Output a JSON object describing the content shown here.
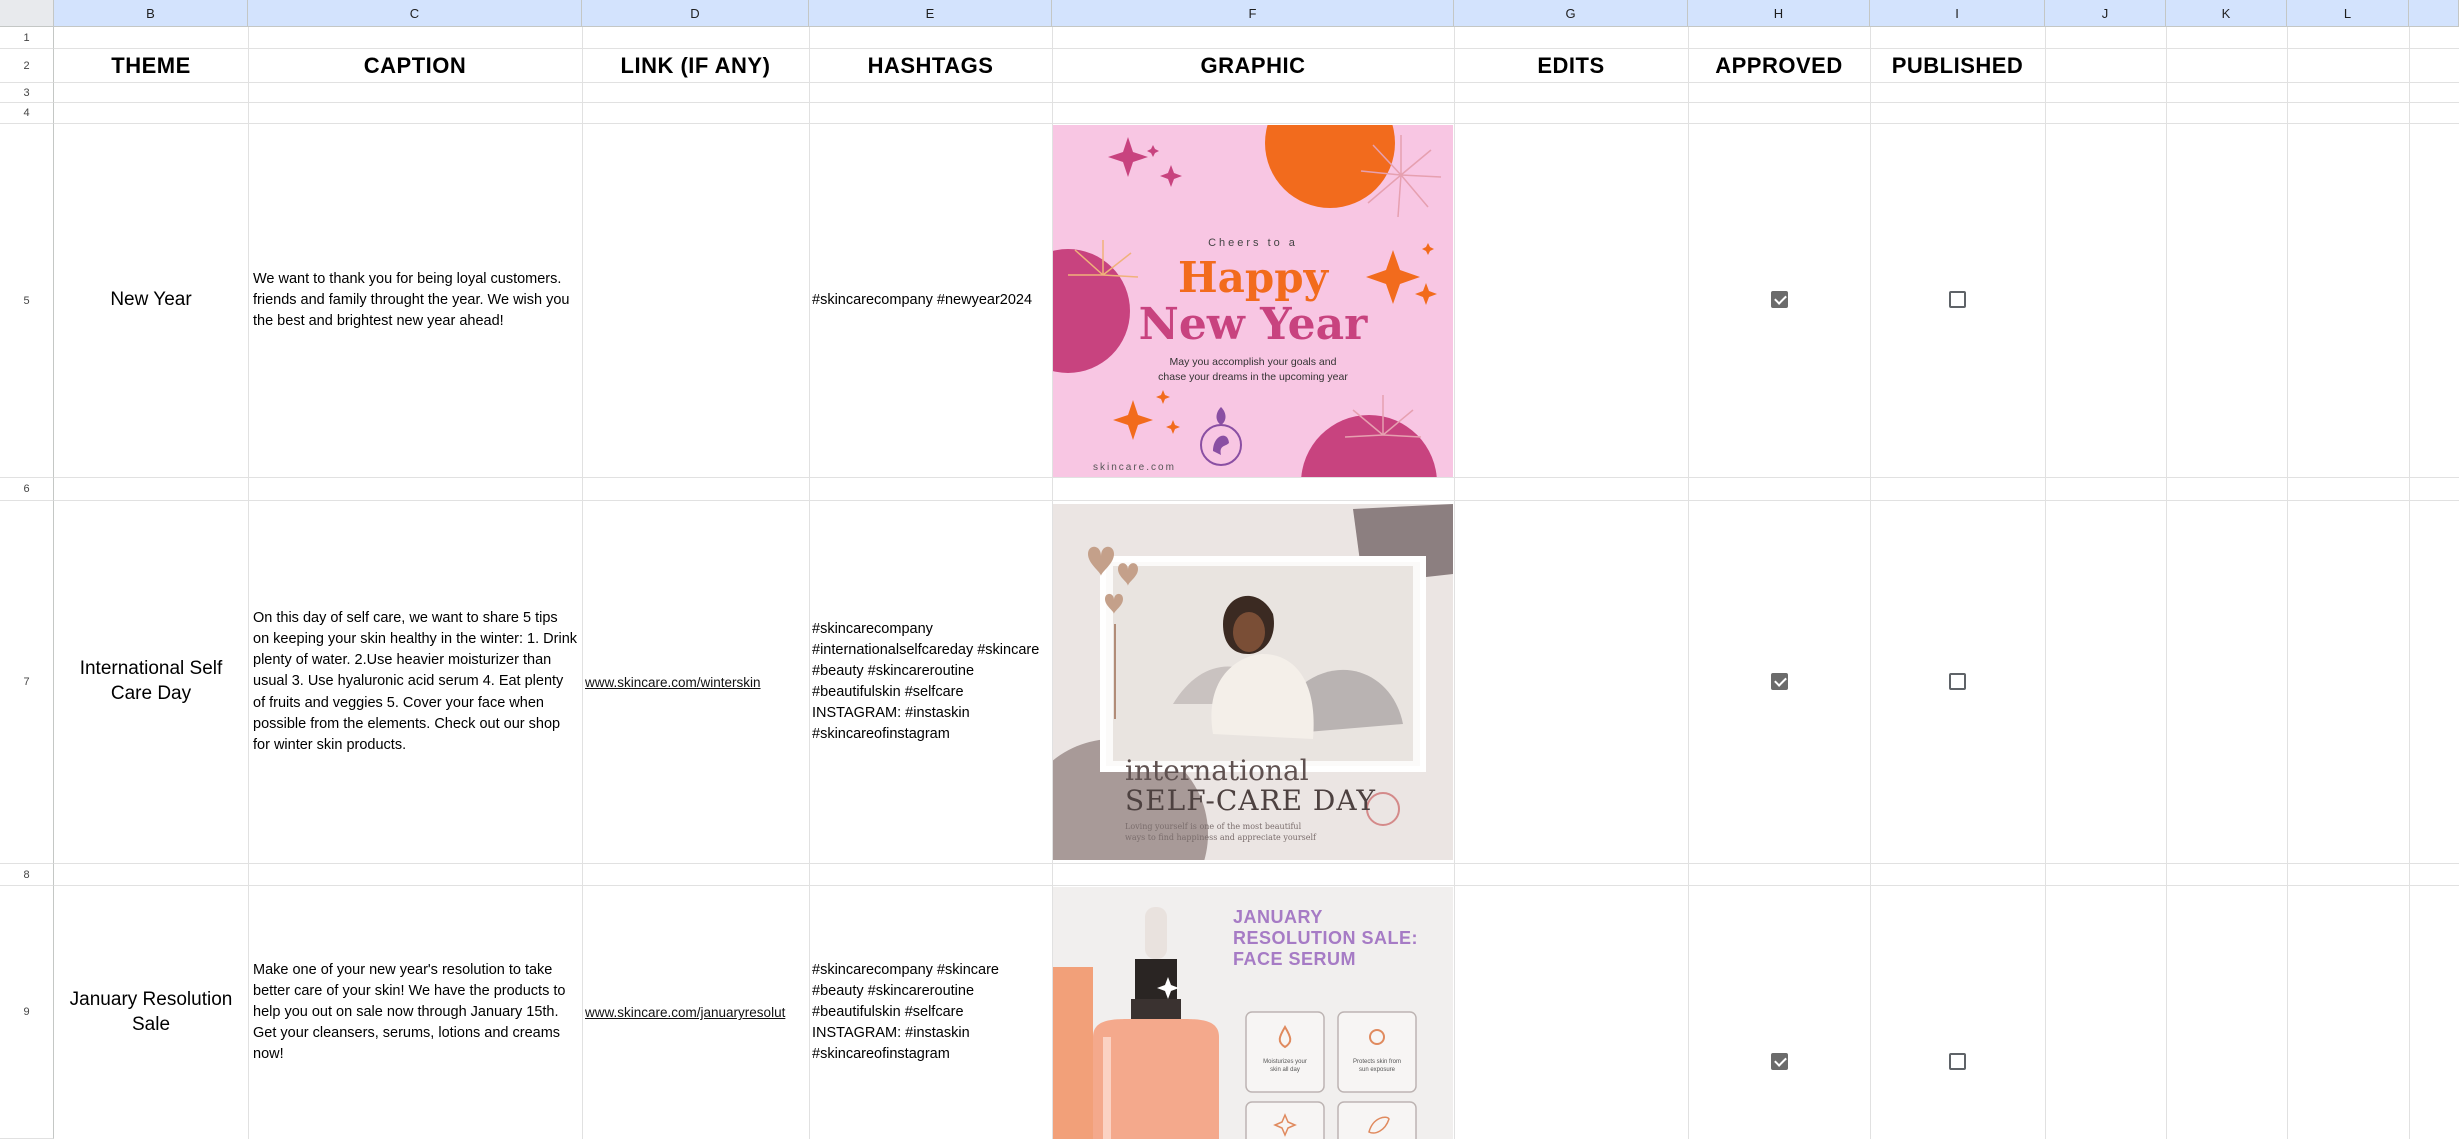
{
  "columns": [
    "B",
    "C",
    "D",
    "E",
    "F",
    "G",
    "H",
    "I",
    "J",
    "K",
    "L"
  ],
  "rows": [
    "1",
    "2",
    "3",
    "4",
    "5",
    "6",
    "7",
    "8",
    "9"
  ],
  "headers": {
    "theme": "THEME",
    "caption": "CAPTION",
    "link": "LINK (IF ANY)",
    "hashtags": "HASHTAGS",
    "graphic": "GRAPHIC",
    "edits": "EDITS",
    "approved": "APPROVED",
    "published": "PUBLISHED"
  },
  "entries": [
    {
      "theme": "New Year",
      "caption": "We want to thank you for being loyal customers. friends and family throught the year. We wish you the best and brightest new year ahead!",
      "link": "",
      "hashtags": "#skincarecompany #newyear2024",
      "approved": true,
      "published": false,
      "graphic": {
        "small": "Cheers to a",
        "line1": "Happy",
        "line2": "New Year",
        "sub1": "May you accomplish your goals and",
        "sub2": "chase your dreams in the upcoming year",
        "footer": "skincare.com"
      }
    },
    {
      "theme": "International Self Care Day",
      "caption": "On this day of self care, we want to share 5 tips on keeping your skin healthy in the winter: 1. Drink plenty of water. 2.Use heavier moisturizer than usual 3. Use hyaluronic acid serum 4. Eat plenty of fruits and veggies 5. Cover your face when possible from the elements. Check out our shop for winter skin products.",
      "link": "www.skincare.com/winterskin",
      "hashtags": "#skincarecompany #internationalselfcareday #skincare #beauty #skincareroutine #beautifulskin #selfcare INSTAGRAM: #instaskin #skincareofinstagram",
      "approved": true,
      "published": false,
      "graphic": {
        "line1": "international",
        "line2": "SELF-CARE DAY",
        "sub1": "Loving yourself is one of the most beautiful",
        "sub2": "ways to find happiness and appreciate yourself"
      }
    },
    {
      "theme": "January Resolution Sale",
      "caption": "Make one of your new year's resolution to take better care of your skin! We have the products to help you out on sale now through January 15th. Get your cleansers, serums, lotions and creams now!",
      "link": "www.skincare.com/januaryresolut",
      "hashtags": "#skincarecompany #skincare #beauty #skincareroutine #beautifulskin #selfcare INSTAGRAM: #instaskin #skincareofinstagram",
      "approved": true,
      "published": false,
      "graphic": {
        "title1": "JANUARY",
        "title2": "RESOLUTION SALE:",
        "title3": "FACE SERUM",
        "feature1a": "Moisturizes your",
        "feature1b": "skin all day",
        "feature2a": "Protects skin from",
        "feature2b": "sun exposure"
      }
    }
  ],
  "colors": {
    "column_header_bg": "#d3e3fd",
    "grid": "#e1e1e1",
    "checkbox_checked": "#6b6b6b"
  }
}
